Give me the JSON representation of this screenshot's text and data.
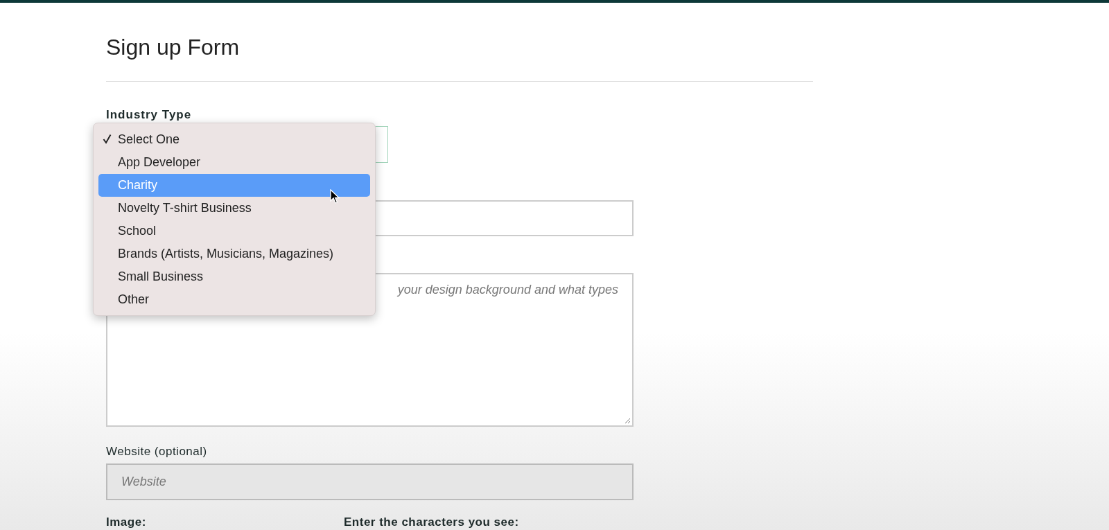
{
  "title": "Sign up Form",
  "fields": [
    {
      "kind": "select",
      "label": "Industry Type"
    },
    {
      "kind": "input"
    },
    {
      "kind": "textarea",
      "placeholder": "your design background and what types"
    },
    {
      "kind": "input",
      "label": "Website (optional)",
      "placeholder": "Website"
    }
  ],
  "dropdown": {
    "options": [
      {
        "label": "Select One",
        "checked": true,
        "selected": false
      },
      {
        "label": "App Developer",
        "checked": false,
        "selected": false
      },
      {
        "label": "Charity",
        "checked": false,
        "selected": true
      },
      {
        "label": "Novelty T-shirt Business",
        "checked": false,
        "selected": false
      },
      {
        "label": "School",
        "checked": false,
        "selected": false
      },
      {
        "label": "Brands (Artists, Musicians, Magazines)",
        "checked": false,
        "selected": false
      },
      {
        "label": "Small Business",
        "checked": false,
        "selected": false
      },
      {
        "label": "Other",
        "checked": false,
        "selected": false
      }
    ]
  },
  "bottom_labels": [
    "Image:",
    "Enter the characters you see:"
  ]
}
